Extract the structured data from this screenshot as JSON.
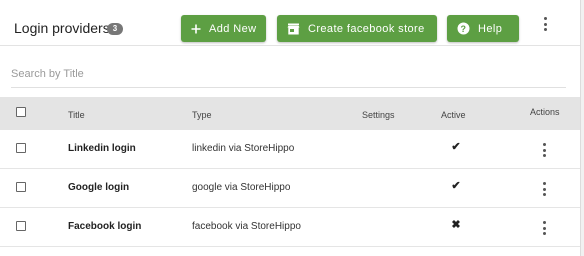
{
  "header": {
    "title": "Login providers",
    "count": "3",
    "buttons": {
      "add_new": "Add New",
      "create_store": "Create facebook store",
      "help": "Help"
    }
  },
  "search": {
    "placeholder": "Search by Title",
    "value": ""
  },
  "table": {
    "columns": {
      "title": "Title",
      "type": "Type",
      "settings": "Settings",
      "active": "Active",
      "actions": "Actions"
    },
    "rows": [
      {
        "title": "Linkedin login",
        "type": "linkedin via StoreHippo",
        "active": "✔"
      },
      {
        "title": "Google login",
        "type": "google via StoreHippo",
        "active": "✔"
      },
      {
        "title": "Facebook login",
        "type": "facebook via StoreHippo",
        "active": "✖"
      }
    ]
  },
  "colors": {
    "button_green": "#5d9f43",
    "header_bg": "#e4e4e4",
    "badge": "#777777"
  },
  "icons": {
    "add": "plus-icon",
    "store": "store-icon",
    "help": "help-icon",
    "more": "more-vertical-icon"
  }
}
